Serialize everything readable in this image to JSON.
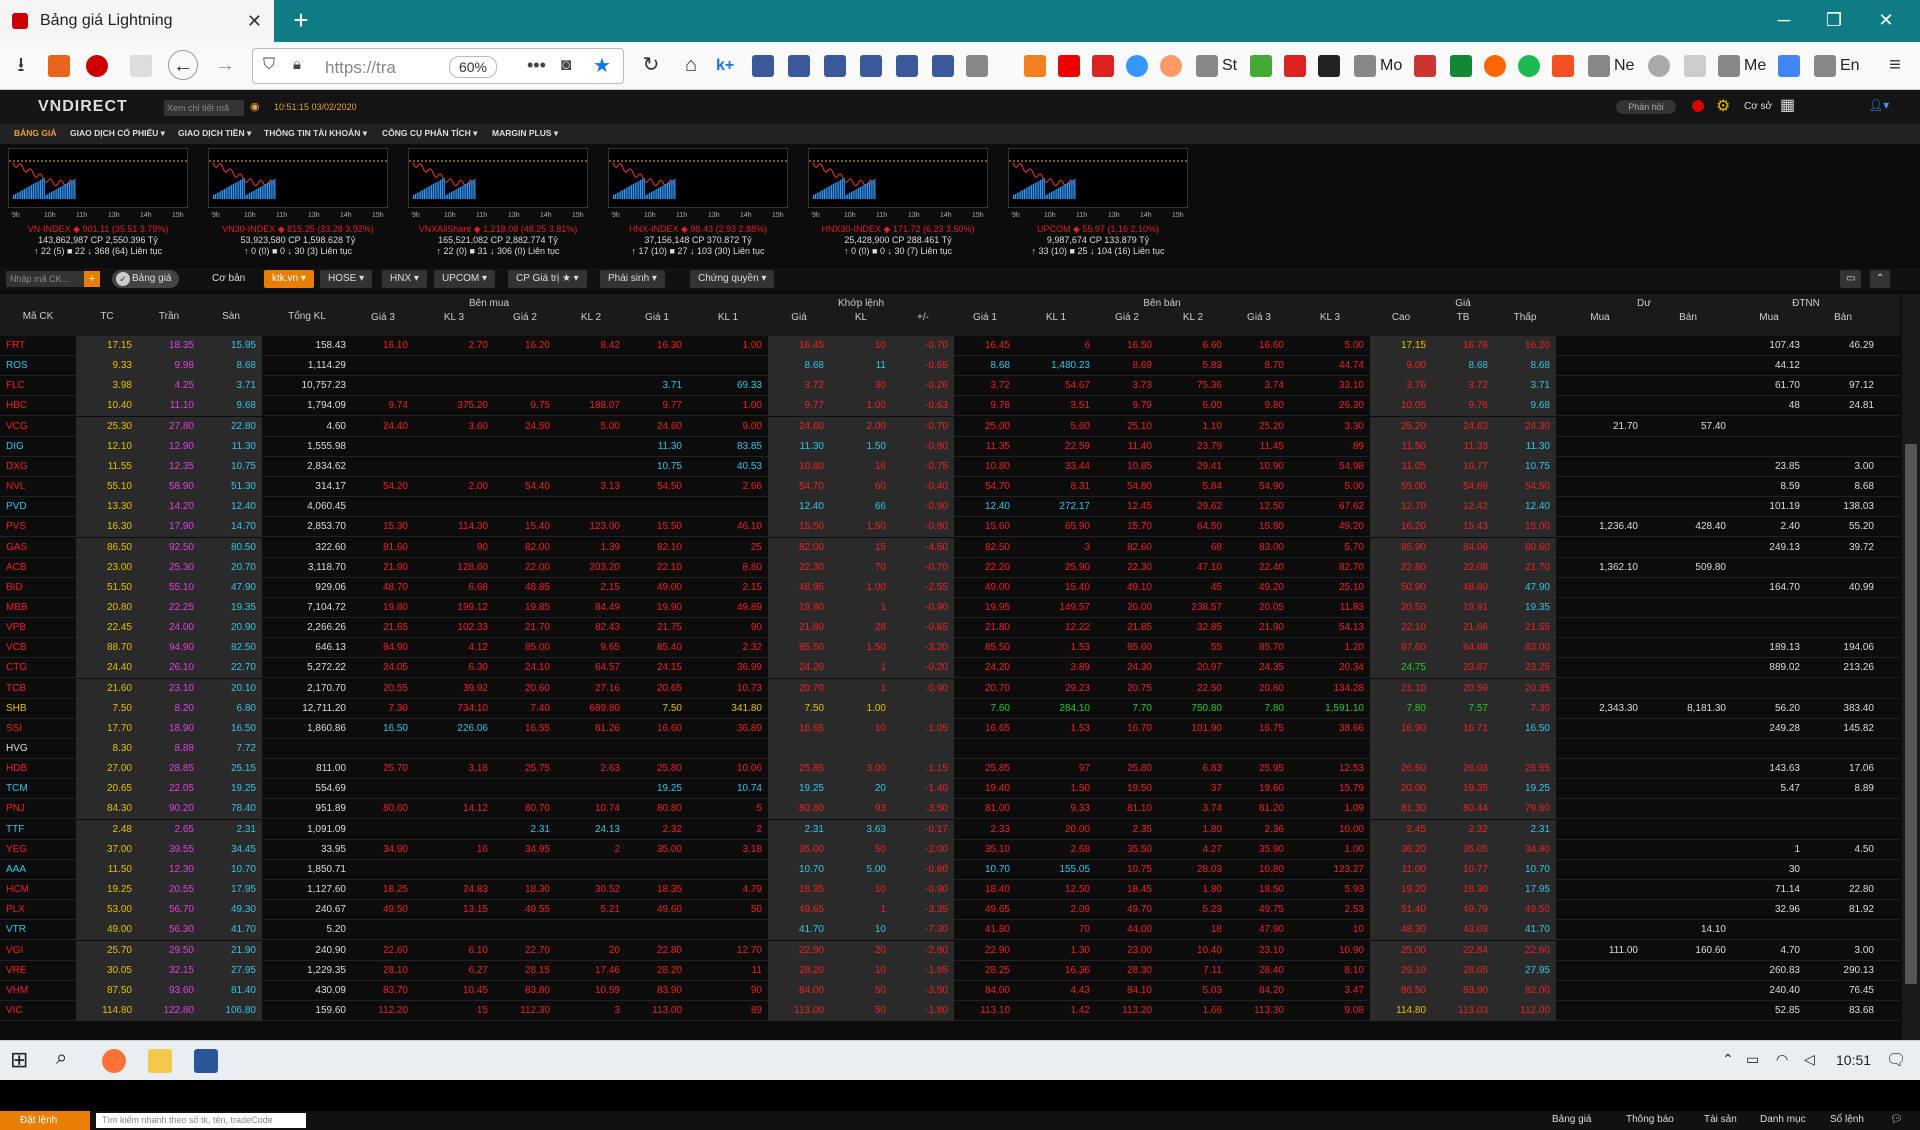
{
  "browser": {
    "tab_title": "Bảng giá Lightning",
    "url": "https://tra",
    "zoom": "60%",
    "bookmarks": [
      "k+",
      "St",
      "Mo",
      "Ne",
      "Me",
      "En"
    ]
  },
  "app": {
    "logo": "VNDIRECT",
    "search_placeholder": "Xem chỉ tiết mã",
    "clock": "10:51:15 03/02/2020",
    "feedback": "Phản hồi",
    "mode": "Cơ sở",
    "menu": [
      "BẢNG GIÁ",
      "GIAO DỊCH CỔ PHIẾU ▾",
      "GIAO DỊCH TIỀN ▾",
      "THÔNG TIN TÀI KHOẢN ▾",
      "CÔNG CỤ PHÂN TÍCH ▾",
      "MARGIN PLUS ▾"
    ],
    "chart_times": [
      "9h",
      "10h",
      "11h",
      "13h",
      "14h",
      "15h"
    ],
    "indices": [
      {
        "name": "VN-INDEX ◆ 901.11 (35.51 3.79%)",
        "line2": "143,862,987 CP 2,550.396 Tỷ",
        "line3": "↑ 22 (5) ■ 22 ↓ 368 (64) Liên tục",
        "color": "#e02020"
      },
      {
        "name": "VN30-INDEX ◆ 815.25 (33.28 3.92%)",
        "line2": "53,923,580 CP 1,598.628 Tỷ",
        "line3": "↑ 0 (0) ■ 0 ↓ 30 (3) Liên tục",
        "color": "#e02020"
      },
      {
        "name": "VNXAllShare ◆ 1,218.08 (48.25 3.81%)",
        "line2": "165,521,082 CP 2,882.774 Tỷ",
        "line3": "↑ 22 (0) ■ 31 ↓ 306 (0) Liên tục",
        "color": "#e02020"
      },
      {
        "name": "HNX-INDEX ◆ 98.43 (2.93 2.88%)",
        "line2": "37,156,148 CP 370.872 Tỷ",
        "line3": "↑ 17 (10) ■ 27 ↓ 103 (30) Liên tục",
        "color": "#e02020"
      },
      {
        "name": "HNX30-INDEX ◆ 171.72 (6.23 3.50%)",
        "line2": "25,428,900 CP 288.461 Tỷ",
        "line3": "↑ 0 (0) ■ 0 ↓ 30 (7) Liên tục",
        "color": "#e02020"
      },
      {
        "name": "UPCOM ◆ 55.97 (1.16 2.10%)",
        "line2": "9,987,674 CP 133.879 Tỷ",
        "line3": "↑ 33 (10) ■ 25 ↓ 104 (16) Liên tục",
        "color": "#e02020"
      }
    ],
    "toolbar": {
      "search": "Nhập mã CK...",
      "tabs": [
        "Bảng giá",
        "Cơ bản",
        "ktk.vn ▾",
        "HOSE ▾",
        "HNX ▾",
        "UPCOM ▾",
        "CP Giá trị ★ ▾",
        "Phái sinh ▾",
        "Chứng quyền ▾"
      ]
    },
    "header_groups": [
      "Bên mua",
      "Khớp lệnh",
      "Bên bán",
      "Giá",
      "Dư",
      "ĐTNN"
    ],
    "columns": [
      "Mã CK",
      "TC",
      "Trần",
      "Sàn",
      "Tổng KL",
      "Giá 3",
      "KL 3",
      "Giá 2",
      "KL 2",
      "Giá 1",
      "KL 1",
      "Giá",
      "KL",
      "+/-",
      "Giá 1",
      "KL 1",
      "Giá 2",
      "KL 2",
      "Giá 3",
      "KL 3",
      "Cao",
      "TB",
      "Thấp",
      "Mua",
      "Bán",
      "Mua",
      "Bán"
    ],
    "rows": [
      [
        "FRT",
        "17.15",
        "18.35",
        "15.95",
        "158.43",
        "16.10",
        "2.70",
        "16.20",
        "8.42",
        "16.30",
        "1.00",
        "16.45",
        "10",
        "-0.70",
        "16.45",
        "6",
        "16.50",
        "6.60",
        "16.60",
        "5.00",
        "17.15",
        "16.76",
        "16.20",
        "",
        "",
        "107.43",
        "46.29"
      ],
      [
        "ROS",
        "9.33",
        "9.98",
        "8.68",
        "1,114.29",
        "",
        "",
        "",
        "",
        "",
        "",
        "8.68",
        "11",
        "-0.65",
        "8.68",
        "1,480.23",
        "8.69",
        "5.83",
        "8.70",
        "44.74",
        "9.00",
        "8.68",
        "8.68",
        "",
        "",
        "44.12",
        ""
      ],
      [
        "FLC",
        "3.98",
        "4.25",
        "3.71",
        "10,757.23",
        "",
        "",
        "",
        "",
        "3.71",
        "69.33",
        "3.72",
        "30",
        "-0.26",
        "3.72",
        "54.67",
        "3.73",
        "75.36",
        "3.74",
        "33.10",
        "3.76",
        "3.72",
        "3.71",
        "",
        "",
        "61.70",
        "97.12"
      ],
      [
        "HBC",
        "10.40",
        "11.10",
        "9.68",
        "1,794.09",
        "9.74",
        "375.20",
        "9.75",
        "188.07",
        "9.77",
        "1.00",
        "9.77",
        "1.00",
        "-0.63",
        "9.78",
        "3.51",
        "9.79",
        "6.00",
        "9.80",
        "26.30",
        "10.05",
        "9.76",
        "9.68",
        "",
        "",
        "48",
        "24.81"
      ],
      [
        "VCG",
        "25.30",
        "27.80",
        "22.80",
        "4.60",
        "24.40",
        "3.60",
        "24.50",
        "5.00",
        "24.60",
        "9.00",
        "24.60",
        "2.00",
        "-0.70",
        "25.00",
        "5.60",
        "25.10",
        "1.10",
        "25.20",
        "3.30",
        "25.20",
        "24.63",
        "24.30",
        "21.70",
        "57.40",
        "",
        ""
      ],
      [
        "DIG",
        "12.10",
        "12.90",
        "11.30",
        "1,555.98",
        "",
        "",
        "",
        "",
        "11.30",
        "83.85",
        "11.30",
        "1.50",
        "-0.80",
        "11.35",
        "22.59",
        "11.40",
        "23.79",
        "11.45",
        "89",
        "11.50",
        "11.33",
        "11.30",
        "",
        "",
        "",
        ""
      ],
      [
        "DXG",
        "11.55",
        "12.35",
        "10.75",
        "2,834.62",
        "",
        "",
        "",
        "",
        "10.75",
        "40.53",
        "10.80",
        "16",
        "-0.75",
        "10.80",
        "33.44",
        "10.85",
        "29.41",
        "10.90",
        "54.98",
        "11.05",
        "10.77",
        "10.75",
        "",
        "",
        "23.85",
        "3.00"
      ],
      [
        "NVL",
        "55.10",
        "58.90",
        "51.30",
        "314.17",
        "54.20",
        "2.00",
        "54.40",
        "3.13",
        "54.50",
        "2.66",
        "54.70",
        "60",
        "-0.40",
        "54.70",
        "8.31",
        "54.80",
        "5.84",
        "54.90",
        "5.00",
        "55.00",
        "54.69",
        "54.50",
        "",
        "",
        "8.59",
        "8.68"
      ],
      [
        "PVD",
        "13.30",
        "14.20",
        "12.40",
        "4,060.45",
        "",
        "",
        "",
        "",
        "",
        "",
        "12.40",
        "66",
        "-0.90",
        "12.40",
        "272.17",
        "12.45",
        "29.62",
        "12.50",
        "67.62",
        "12.70",
        "12.42",
        "12.40",
        "",
        "",
        "101.19",
        "138.03"
      ],
      [
        "PVS",
        "16.30",
        "17.90",
        "14.70",
        "2,853.70",
        "15.30",
        "114.30",
        "15.40",
        "123.00",
        "15.50",
        "46.10",
        "15.50",
        "1.50",
        "-0.80",
        "15.60",
        "65.90",
        "15.70",
        "64.50",
        "15.80",
        "49.20",
        "16.20",
        "15.43",
        "15.00",
        "1,236.40",
        "428.40",
        "2.40",
        "55.20"
      ],
      [
        "GAS",
        "86.50",
        "92.50",
        "80.50",
        "322.60",
        "81.60",
        "90",
        "82.00",
        "1.39",
        "82.10",
        "25",
        "82.00",
        "15",
        "-4.50",
        "82.50",
        "3",
        "82.60",
        "68",
        "83.00",
        "5.70",
        "85.90",
        "84.06",
        "80.60",
        "",
        "",
        "249.13",
        "39.72"
      ],
      [
        "ACB",
        "23.00",
        "25.30",
        "20.70",
        "3,118.70",
        "21.90",
        "128.60",
        "22.00",
        "203.20",
        "22.10",
        "8.80",
        "22.30",
        "70",
        "-0.70",
        "22.20",
        "25.90",
        "22.30",
        "47.10",
        "22.40",
        "82.70",
        "22.80",
        "22.08",
        "21.70",
        "1,362.10",
        "509.80",
        "",
        ""
      ],
      [
        "BID",
        "51.50",
        "55.10",
        "47.90",
        "929.06",
        "48.70",
        "6.68",
        "48.85",
        "2.15",
        "49.00",
        "2.15",
        "48.95",
        "1.00",
        "-2.55",
        "49.00",
        "15.40",
        "49.10",
        "45",
        "49.20",
        "25.10",
        "50.90",
        "48.80",
        "47.90",
        "",
        "",
        "164.70",
        "40.99"
      ],
      [
        "MBB",
        "20.80",
        "22.25",
        "19.35",
        "7,104.72",
        "19.80",
        "199.12",
        "19.85",
        "84.49",
        "19.90",
        "49.89",
        "19.90",
        "1",
        "-0.90",
        "19.95",
        "149.57",
        "20.00",
        "238.57",
        "20.05",
        "11.83",
        "20.50",
        "19.91",
        "19.35",
        "",
        "",
        "",
        ""
      ],
      [
        "VPB",
        "22.45",
        "24.00",
        "20.90",
        "2,266.26",
        "21.65",
        "102.33",
        "21.70",
        "82.43",
        "21.75",
        "90",
        "21.80",
        "28",
        "-0.65",
        "21.80",
        "12.22",
        "21.85",
        "32.85",
        "21.90",
        "54.13",
        "22.10",
        "21.66",
        "21.55",
        "",
        "",
        "",
        ""
      ],
      [
        "VCB",
        "88.70",
        "94.90",
        "82.50",
        "646.13",
        "84.90",
        "4.12",
        "85.00",
        "9.65",
        "85.40",
        "2.32",
        "85.50",
        "1.50",
        "-3.20",
        "85.50",
        "1.53",
        "85.60",
        "55",
        "85.70",
        "1.20",
        "87.60",
        "84.88",
        "83.00",
        "",
        "",
        "189.13",
        "194.06"
      ],
      [
        "CTG",
        "24.40",
        "26.10",
        "22.70",
        "5,272.22",
        "24.05",
        "6.30",
        "24.10",
        "64.57",
        "24.15",
        "36.99",
        "24.20",
        "1",
        "-0.20",
        "24.20",
        "3.89",
        "24.30",
        "20.97",
        "24.35",
        "20.34",
        "24.75",
        "23.87",
        "23.25",
        "",
        "",
        "889.02",
        "213.26"
      ],
      [
        "TCB",
        "21.60",
        "23.10",
        "20.10",
        "2,170.70",
        "20.55",
        "39.92",
        "20.60",
        "27.16",
        "20.65",
        "10.73",
        "20.70",
        "1",
        "-0.90",
        "20.70",
        "29.23",
        "20.75",
        "22.50",
        "20.80",
        "134.28",
        "21.10",
        "20.59",
        "20.35",
        "",
        "",
        "",
        ""
      ],
      [
        "SHB",
        "7.50",
        "8.20",
        "6.80",
        "12,711.20",
        "7.30",
        "734.10",
        "7.40",
        "689.80",
        "7.50",
        "341.80",
        "7.50",
        "1.00",
        "",
        "7.60",
        "284.10",
        "7.70",
        "750.80",
        "7.80",
        "1,591.10",
        "7.80",
        "7.57",
        "7.30",
        "2,343.30",
        "8,181.30",
        "56.20",
        "383.40"
      ],
      [
        "SSI",
        "17.70",
        "18.90",
        "16.50",
        "1,860.86",
        "16.50",
        "226.06",
        "16.55",
        "81.26",
        "16.60",
        "36.89",
        "16.65",
        "10",
        "-1.05",
        "16.65",
        "1.53",
        "16.70",
        "101.90",
        "16.75",
        "38.66",
        "16.90",
        "16.71",
        "16.50",
        "",
        "",
        "249.28",
        "145.82"
      ],
      [
        "HVG",
        "8.30",
        "8.88",
        "7.72",
        "",
        "",
        "",
        "",
        "",
        "",
        "",
        "",
        "",
        "",
        "",
        "",
        "",
        "",
        "",
        "",
        "",
        "",
        "",
        "",
        "",
        "",
        ""
      ],
      [
        "HDB",
        "27.00",
        "28.85",
        "25.15",
        "811.00",
        "25.70",
        "3.18",
        "25.75",
        "2.63",
        "25.80",
        "10.06",
        "25.85",
        "3.00",
        "-1.15",
        "25.85",
        "97",
        "25.80",
        "6.83",
        "25.95",
        "12.53",
        "26.60",
        "26.03",
        "25.55",
        "",
        "",
        "143.63",
        "17.06"
      ],
      [
        "TCM",
        "20.65",
        "22.05",
        "19.25",
        "554.69",
        "",
        "",
        "",
        "",
        "19.25",
        "10.74",
        "19.25",
        "20",
        "-1.40",
        "19.40",
        "1.50",
        "19.50",
        "37",
        "19.60",
        "15.79",
        "20.00",
        "19.35",
        "19.25",
        "",
        "",
        "5.47",
        "8.89"
      ],
      [
        "PNJ",
        "84.30",
        "90.20",
        "78.40",
        "951.89",
        "80.60",
        "14.12",
        "80.70",
        "10.74",
        "80.80",
        "5",
        "80.80",
        "93",
        "-3.50",
        "81.00",
        "9.33",
        "81.10",
        "3.74",
        "81.20",
        "1.09",
        "81.30",
        "80.44",
        "79.60",
        "",
        "",
        "",
        ""
      ],
      [
        "TTF",
        "2.48",
        "2.65",
        "2.31",
        "1,091.09",
        "",
        "",
        "2.31",
        "24.13",
        "2.32",
        "2",
        "2.31",
        "3.63",
        "-0.17",
        "2.33",
        "20.00",
        "2.35",
        "1.80",
        "2.36",
        "10.00",
        "2.45",
        "2.32",
        "2.31",
        "",
        "",
        "",
        ""
      ],
      [
        "YEG",
        "37.00",
        "39.55",
        "34.45",
        "33.95",
        "34.90",
        "16",
        "34.95",
        "2",
        "35.00",
        "3.18",
        "35.00",
        "50",
        "-2.00",
        "35.10",
        "2.68",
        "35.50",
        "4.27",
        "35.90",
        "1.00",
        "36.20",
        "35.05",
        "34.90",
        "",
        "",
        "1",
        "4.50"
      ],
      [
        "AAA",
        "11.50",
        "12.30",
        "10.70",
        "1,850.71",
        "",
        "",
        "",
        "",
        "",
        "",
        "10.70",
        "5.00",
        "-0.80",
        "10.70",
        "155.05",
        "10.75",
        "28.03",
        "10.80",
        "123.27",
        "11.00",
        "10.77",
        "10.70",
        "",
        "",
        "30",
        ""
      ],
      [
        "HCM",
        "19.25",
        "20.55",
        "17.95",
        "1,127.60",
        "18.25",
        "24.83",
        "18.30",
        "30.52",
        "18.35",
        "4.79",
        "18.35",
        "10",
        "-0.90",
        "18.40",
        "12.50",
        "18.45",
        "1.80",
        "18.50",
        "5.93",
        "19.20",
        "18.30",
        "17.95",
        "",
        "",
        "71.14",
        "22.80"
      ],
      [
        "PLX",
        "53.00",
        "56.70",
        "49.30",
        "240.67",
        "49.50",
        "13.15",
        "49.55",
        "5.21",
        "49.60",
        "50",
        "49.65",
        "1",
        "-3.35",
        "49.65",
        "2.09",
        "49.70",
        "5.23",
        "49.75",
        "2.53",
        "51.40",
        "49.79",
        "49.50",
        "",
        "",
        "32.96",
        "81.92"
      ],
      [
        "VTR",
        "49.00",
        "56.30",
        "41.70",
        "5.20",
        "",
        "",
        "",
        "",
        "",
        "",
        "41.70",
        "10",
        "-7.30",
        "41.80",
        "70",
        "44.00",
        "18",
        "47.90",
        "10",
        "48.30",
        "43.03",
        "41.70",
        "",
        "14.10",
        "",
        ""
      ],
      [
        "VGI",
        "25.70",
        "29.50",
        "21.90",
        "240.90",
        "22.60",
        "6.10",
        "22.70",
        "20",
        "22.80",
        "12.70",
        "22.90",
        "20",
        "-2.80",
        "22.90",
        "1.30",
        "23.00",
        "10.40",
        "23.10",
        "10.90",
        "25.00",
        "22.84",
        "22.60",
        "111.00",
        "160.60",
        "4.70",
        "3.00"
      ],
      [
        "VRE",
        "30.05",
        "32.15",
        "27.95",
        "1,229.35",
        "28.10",
        "6.27",
        "28.15",
        "17.46",
        "28.20",
        "11",
        "28.20",
        "10",
        "-1.85",
        "28.25",
        "16.36",
        "28.30",
        "7.11",
        "28.40",
        "8.10",
        "29.10",
        "28.05",
        "27.95",
        "",
        "",
        "260.83",
        "290.13"
      ],
      [
        "VHM",
        "87.50",
        "93.60",
        "81.40",
        "430.09",
        "83.70",
        "10.45",
        "83.80",
        "10.59",
        "83.90",
        "90",
        "84.00",
        "50",
        "-3.50",
        "84.00",
        "4.43",
        "84.10",
        "5.03",
        "84.20",
        "3.47",
        "86.50",
        "83.90",
        "82.00",
        "",
        "",
        "240.40",
        "76.45"
      ],
      [
        "VIC",
        "114.80",
        "122.80",
        "106.80",
        "159.60",
        "112.20",
        "15",
        "112.30",
        "3",
        "113.00",
        "89",
        "113.00",
        "50",
        "-1.80",
        "113.10",
        "1.42",
        "113.20",
        "1.66",
        "113.30",
        "9.08",
        "114.80",
        "113.03",
        "112.00",
        "",
        "",
        "52.85",
        "83.68"
      ]
    ],
    "footer": {
      "order": "Đặt lệnh",
      "quick_search": "Tìm kiếm nhanh theo số tk, tên, tradeCode",
      "items": [
        "Bảng giá",
        "Thông báo",
        "Tài sản",
        "Danh mục",
        "Sổ lệnh"
      ]
    },
    "colors": {
      "up": "#22cc22",
      "down": "#ee2222",
      "ref": "#e8c000",
      "ceil": "#e040e0",
      "floor": "#33c6e8"
    }
  },
  "taskbar": {
    "clock": "10:51"
  }
}
